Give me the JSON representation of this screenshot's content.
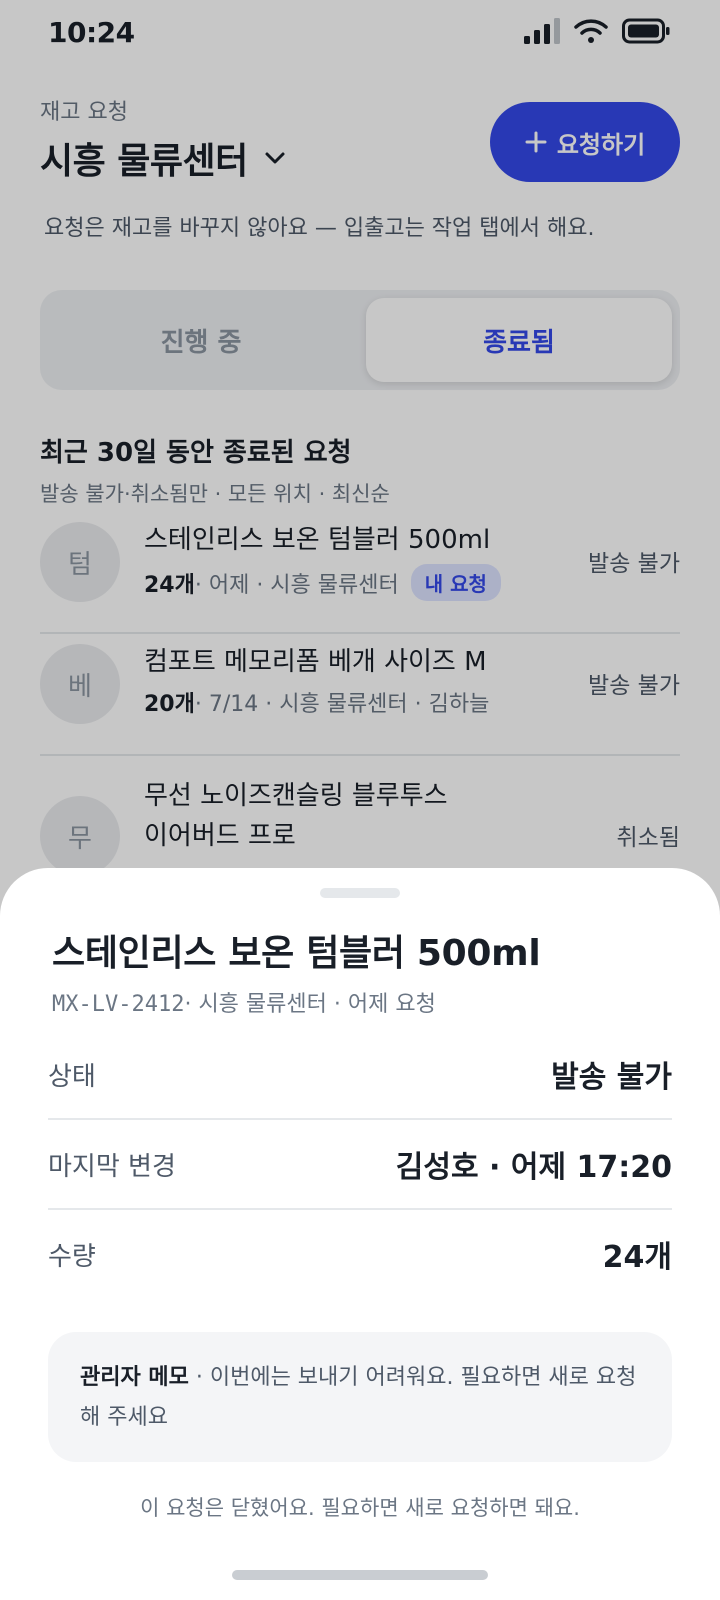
{
  "status_bar": {
    "time": "10:24"
  },
  "header": {
    "eyebrow": "재고 요청",
    "warehouse": "시흥 물류센터",
    "request_button": "요청하기",
    "subtitle": "요청은 재고를 바꾸지 않아요 — 입출고는 작업 탭에서 해요."
  },
  "tabs": [
    {
      "label": "진행 중",
      "selected": false
    },
    {
      "label": "종료됨",
      "selected": true
    }
  ],
  "section": {
    "title": "최근 30일 동안 종료된 요청",
    "filter": "발송 불가·취소됨만 · 모든 위치 · 최신순"
  },
  "items": [
    {
      "initial": "텀",
      "name": "스테인리스 보온 텀블러 500ml",
      "qty": "24개",
      "meta": " · 어제 · 시흥 물류센터",
      "badge": "내 요청",
      "status": "발송 불가"
    },
    {
      "initial": "베",
      "name": "컴포트 메모리폼 베개 사이즈 M",
      "qty": "20개",
      "meta": " · 7/14 · 시흥 물류센터 · 김하늘",
      "badge": "",
      "status": "발송 불가"
    },
    {
      "initial": "무",
      "name_line1": "무선 노이즈캔슬링 블루투스",
      "name_line2": "이어버드 프로",
      "status": "취소됨"
    }
  ],
  "sheet": {
    "title": "스테인리스 보온 텀블러 500ml",
    "sku": "MX-LV-2412",
    "meta": " · 시흥 물류센터 · 어제 요청",
    "rows": [
      {
        "label": "상태",
        "value": "발송 불가"
      },
      {
        "label": "마지막 변경",
        "value": "김성호 · 어제 17:20"
      },
      {
        "label": "수량",
        "value": "24개"
      }
    ],
    "memo_label": "관리자 메모",
    "memo_text": " · 이번에는 보내기 어려워요. 필요하면 새로 요청해 주세요",
    "closed_note": "이 요청은 닫혔어요. 필요하면 새로 요청하면 돼요."
  },
  "colors": {
    "accent": "#3448e8",
    "badge_bg": "#dde3ff"
  }
}
